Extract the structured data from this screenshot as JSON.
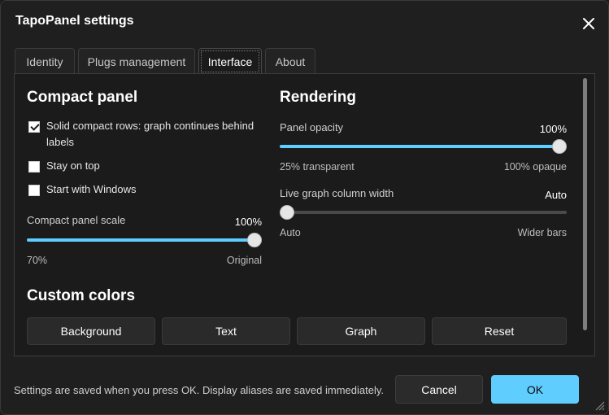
{
  "window": {
    "title": "TapoPanel settings"
  },
  "tabs": [
    {
      "label": "Identity",
      "active": false
    },
    {
      "label": "Plugs management",
      "active": false
    },
    {
      "label": "Interface",
      "active": true
    },
    {
      "label": "About",
      "active": false
    }
  ],
  "compact": {
    "heading": "Compact panel",
    "solid_rows": {
      "label": "Solid compact rows: graph continues behind labels",
      "checked": true
    },
    "stay_on_top": {
      "label": "Stay on top",
      "checked": false
    },
    "start_with_windows": {
      "label": "Start with Windows",
      "checked": false
    },
    "scale": {
      "label": "Compact panel scale",
      "value_text": "100%",
      "min_label": "70%",
      "max_label": "Original",
      "fraction": 1.0
    }
  },
  "rendering": {
    "heading": "Rendering",
    "opacity": {
      "label": "Panel opacity",
      "value_text": "100%",
      "min_label": "25% transparent",
      "max_label": "100% opaque",
      "fraction": 1.0
    },
    "column_width": {
      "label": "Live graph column width",
      "value_text": "Auto",
      "min_label": "Auto",
      "max_label": "Wider bars",
      "fraction": 0.0
    }
  },
  "colors": {
    "heading": "Custom colors",
    "buttons": [
      "Background",
      "Text",
      "Graph",
      "Reset"
    ]
  },
  "footer": {
    "note": "Settings are saved when you press OK. Display aliases are saved immediately.",
    "cancel_label": "Cancel",
    "ok_label": "OK"
  },
  "theme": {
    "accent": "#60cdff",
    "background": "#1f1f1f",
    "panel": "#1b1b1b"
  },
  "icons": {
    "close": "close-icon",
    "check": "checkmark-icon",
    "resize": "resize-grip-icon"
  }
}
